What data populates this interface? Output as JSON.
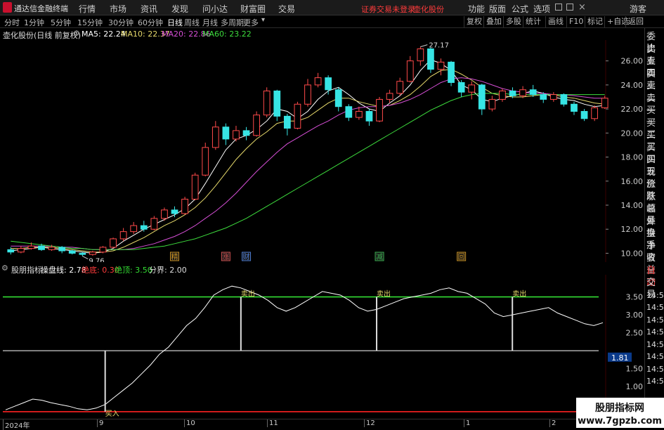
{
  "app": {
    "name": "通达信金融终端"
  },
  "top_menu": [
    "行情",
    "市场",
    "资讯",
    "发现",
    "问小达",
    "财富圈",
    "交易"
  ],
  "status": {
    "login_warning": "证券交易未登录",
    "stock_name": "壶化股份"
  },
  "top_right_menu": [
    "功能",
    "版面",
    "公式",
    "选项"
  ],
  "guest_label": "游客",
  "periods": [
    "分时",
    "1分钟",
    "5分钟",
    "15分钟",
    "30分钟",
    "60分钟",
    "日线",
    "周线",
    "月线",
    "多周期",
    "更多"
  ],
  "active_period": "日线",
  "toolbar_right": [
    "复权",
    "叠加",
    "多股",
    "统计",
    "画线",
    "F10",
    "标记",
    "+自选",
    "返回"
  ],
  "chart_header": {
    "title": "壶化股份(日线 前复权)",
    "ma5": "MA5: 22.24",
    "ma10": "MA10: 22.37",
    "ma20": "MA20: 22.86",
    "ma60": "MA60: 23.22"
  },
  "indicator_header": {
    "name": "股朋指标",
    "line": "操盘线: 2.78",
    "bottom": "绝底: 0.30",
    "top": "绝顶: 3.50",
    "boundary": "分界: 2.00"
  },
  "right_panel": [
    "委比",
    "卖五",
    "卖四",
    "卖三",
    "卖二",
    "卖一",
    "买一",
    "买二",
    "买三",
    "买四",
    "买五",
    "现价",
    "涨跌",
    "涨幅",
    "总量",
    "外盘",
    "换手",
    "净资",
    "收益",
    "自动",
    "交易",
    "14:56",
    "14:56",
    "14:56",
    "14:56",
    "14:56",
    "14:56",
    "14:56",
    "14:56"
  ],
  "x_labels": [
    "2024年",
    "9",
    "10",
    "11",
    "12",
    "1",
    "2"
  ],
  "colors": {
    "up": "#ff4a4a",
    "down": "#37e5e5",
    "ma5": "#ffffff",
    "ma10": "#e6d96b",
    "ma20": "#d64fd6",
    "ma60": "#3ddc3d",
    "indicator": "#ffffff",
    "top_line": "#33dd33",
    "bottom_line": "#ff2222",
    "warning": "#ff3b3b"
  },
  "chart_data": [
    {
      "type": "candlestick",
      "title": "壶化股份(日线 前复权)",
      "y_ticks": [
        "26.00",
        "24.00",
        "22.00",
        "20.00",
        "18.00",
        "16.00",
        "14.00",
        "12.00",
        "10.00"
      ],
      "ylim": [
        9.5,
        27.5
      ],
      "annotations": [
        {
          "label": "27.17",
          "value": 27.17
        },
        {
          "label": "9.76",
          "value": 9.76
        }
      ],
      "markers": [
        "精",
        "涨",
        "财",
        "减",
        "回"
      ],
      "ma_lines": [
        {
          "name": "MA5",
          "values": [
            10.2,
            10.3,
            10.4,
            10.5,
            10.4,
            10.3,
            10.2,
            10.1,
            10.0,
            10.1,
            10.4,
            11.0,
            11.5,
            12.0,
            12.4,
            12.8,
            13.2,
            13.7,
            14.5,
            15.8,
            17.2,
            18.6,
            19.5,
            19.8,
            20.3,
            21.0,
            22.0,
            21.8,
            21.2,
            21.8,
            22.8,
            23.5,
            23.8,
            23.2,
            22.5,
            22.0,
            21.8,
            22.5,
            23.1,
            24.0,
            25.2,
            26.1,
            25.8,
            25.2,
            24.0,
            23.6,
            22.8,
            22.6,
            22.9,
            23.1,
            23.3,
            23.5,
            23.3,
            23.0,
            22.8,
            22.7,
            22.4,
            22.2,
            22.3
          ]
        },
        {
          "name": "MA10",
          "values": [
            10.4,
            10.4,
            10.5,
            10.5,
            10.5,
            10.4,
            10.3,
            10.2,
            10.1,
            10.1,
            10.2,
            10.5,
            10.9,
            11.3,
            11.8,
            12.3,
            12.7,
            13.2,
            13.8,
            14.6,
            15.6,
            16.7,
            17.8,
            18.7,
            19.5,
            20.1,
            20.8,
            21.0,
            21.0,
            21.3,
            21.9,
            22.5,
            22.9,
            22.9,
            22.6,
            22.4,
            22.2,
            22.3,
            22.7,
            23.2,
            23.9,
            24.7,
            25.2,
            25.3,
            24.9,
            24.4,
            23.8,
            23.3,
            23.1,
            23.0,
            23.0,
            23.1,
            23.2,
            23.2,
            23.0,
            22.9,
            22.7,
            22.5,
            22.4
          ]
        },
        {
          "name": "MA20",
          "values": [
            10.6,
            10.6,
            10.6,
            10.6,
            10.6,
            10.5,
            10.5,
            10.4,
            10.3,
            10.3,
            10.3,
            10.3,
            10.4,
            10.6,
            10.8,
            11.1,
            11.4,
            11.8,
            12.3,
            12.9,
            13.5,
            14.2,
            15.0,
            15.9,
            16.8,
            17.6,
            18.4,
            19.1,
            19.6,
            20.1,
            20.6,
            21.0,
            21.5,
            21.9,
            22.1,
            22.2,
            22.2,
            22.3,
            22.5,
            22.8,
            23.2,
            23.7,
            24.2,
            24.5,
            24.6,
            24.5,
            24.3,
            24.0,
            23.7,
            23.5,
            23.4,
            23.3,
            23.3,
            23.2,
            23.2,
            23.1,
            23.0,
            22.9,
            22.9
          ]
        },
        {
          "name": "MA60",
          "values": [
            11.0,
            10.9,
            10.8,
            10.7,
            10.6,
            10.5,
            10.4,
            10.4,
            10.3,
            10.3,
            10.3,
            10.3,
            10.3,
            10.4,
            10.5,
            10.6,
            10.8,
            11.0,
            11.2,
            11.5,
            11.8,
            12.1,
            12.5,
            12.9,
            13.4,
            13.9,
            14.4,
            14.9,
            15.4,
            15.9,
            16.4,
            16.9,
            17.4,
            17.9,
            18.4,
            18.9,
            19.4,
            19.9,
            20.4,
            20.9,
            21.4,
            21.9,
            22.3,
            22.7,
            23.0,
            23.2,
            23.3,
            23.3,
            23.3,
            23.2,
            23.2,
            23.2,
            23.2,
            23.2,
            23.2,
            23.2,
            23.2,
            23.2,
            23.2
          ]
        }
      ],
      "candles": [
        {
          "o": 10.3,
          "c": 10.1,
          "h": 10.5,
          "l": 9.9
        },
        {
          "o": 10.1,
          "c": 10.4,
          "h": 10.6,
          "l": 10.0
        },
        {
          "o": 10.4,
          "c": 10.6,
          "h": 10.9,
          "l": 10.3
        },
        {
          "o": 10.6,
          "c": 10.3,
          "h": 10.8,
          "l": 10.2
        },
        {
          "o": 10.3,
          "c": 10.5,
          "h": 10.7,
          "l": 10.2
        },
        {
          "o": 10.5,
          "c": 10.2,
          "h": 10.6,
          "l": 10.0
        },
        {
          "o": 10.2,
          "c": 10.0,
          "h": 10.3,
          "l": 9.9
        },
        {
          "o": 10.0,
          "c": 9.9,
          "h": 10.1,
          "l": 9.76
        },
        {
          "o": 9.9,
          "c": 10.1,
          "h": 10.2,
          "l": 9.8
        },
        {
          "o": 10.1,
          "c": 10.5,
          "h": 10.6,
          "l": 10.0
        },
        {
          "o": 10.5,
          "c": 11.2,
          "h": 11.3,
          "l": 10.4
        },
        {
          "o": 11.2,
          "c": 11.8,
          "h": 12.1,
          "l": 11.0
        },
        {
          "o": 11.8,
          "c": 12.3,
          "h": 12.6,
          "l": 11.6
        },
        {
          "o": 12.3,
          "c": 12.0,
          "h": 12.7,
          "l": 11.8
        },
        {
          "o": 12.0,
          "c": 12.9,
          "h": 13.1,
          "l": 11.9
        },
        {
          "o": 12.9,
          "c": 13.6,
          "h": 13.8,
          "l": 12.7
        },
        {
          "o": 13.6,
          "c": 13.3,
          "h": 13.9,
          "l": 13.0
        },
        {
          "o": 13.3,
          "c": 14.5,
          "h": 14.7,
          "l": 13.2
        },
        {
          "o": 14.5,
          "c": 16.5,
          "h": 16.7,
          "l": 14.4
        },
        {
          "o": 16.5,
          "c": 18.8,
          "h": 19.2,
          "l": 16.4
        },
        {
          "o": 18.8,
          "c": 20.5,
          "h": 21.0,
          "l": 18.6
        },
        {
          "o": 20.5,
          "c": 19.5,
          "h": 20.8,
          "l": 19.0
        },
        {
          "o": 19.5,
          "c": 20.2,
          "h": 20.6,
          "l": 19.3
        },
        {
          "o": 20.2,
          "c": 19.8,
          "h": 20.5,
          "l": 19.4
        },
        {
          "o": 19.8,
          "c": 21.5,
          "h": 21.8,
          "l": 19.7
        },
        {
          "o": 21.5,
          "c": 23.5,
          "h": 23.8,
          "l": 21.3
        },
        {
          "o": 23.5,
          "c": 21.4,
          "h": 23.6,
          "l": 21.0
        },
        {
          "o": 21.4,
          "c": 20.4,
          "h": 21.6,
          "l": 19.8
        },
        {
          "o": 20.4,
          "c": 22.4,
          "h": 22.6,
          "l": 20.3
        },
        {
          "o": 22.4,
          "c": 24.0,
          "h": 24.5,
          "l": 22.2
        },
        {
          "o": 24.0,
          "c": 24.6,
          "h": 25.0,
          "l": 23.8
        },
        {
          "o": 24.6,
          "c": 23.6,
          "h": 24.8,
          "l": 23.2
        },
        {
          "o": 23.6,
          "c": 22.2,
          "h": 23.8,
          "l": 21.8
        },
        {
          "o": 22.2,
          "c": 21.3,
          "h": 22.4,
          "l": 21.0
        },
        {
          "o": 21.3,
          "c": 21.8,
          "h": 22.2,
          "l": 21.1
        },
        {
          "o": 21.8,
          "c": 21.0,
          "h": 22.0,
          "l": 20.6
        },
        {
          "o": 21.0,
          "c": 22.8,
          "h": 23.0,
          "l": 20.9
        },
        {
          "o": 22.8,
          "c": 23.3,
          "h": 23.6,
          "l": 22.5
        },
        {
          "o": 23.3,
          "c": 24.3,
          "h": 24.6,
          "l": 23.1
        },
        {
          "o": 24.3,
          "c": 26.0,
          "h": 26.4,
          "l": 24.2
        },
        {
          "o": 26.0,
          "c": 27.0,
          "h": 27.17,
          "l": 25.6
        },
        {
          "o": 27.0,
          "c": 25.3,
          "h": 27.1,
          "l": 25.0
        },
        {
          "o": 25.3,
          "c": 25.9,
          "h": 26.2,
          "l": 24.8
        },
        {
          "o": 25.9,
          "c": 24.2,
          "h": 26.0,
          "l": 23.9
        },
        {
          "o": 24.2,
          "c": 23.4,
          "h": 24.4,
          "l": 23.0
        },
        {
          "o": 23.4,
          "c": 24.0,
          "h": 24.3,
          "l": 22.8
        },
        {
          "o": 24.0,
          "c": 22.0,
          "h": 24.1,
          "l": 21.5
        },
        {
          "o": 22.0,
          "c": 22.8,
          "h": 23.1,
          "l": 21.8
        },
        {
          "o": 22.8,
          "c": 23.5,
          "h": 23.7,
          "l": 22.6
        },
        {
          "o": 23.5,
          "c": 23.1,
          "h": 23.8,
          "l": 22.9
        },
        {
          "o": 23.1,
          "c": 23.6,
          "h": 23.9,
          "l": 22.9
        },
        {
          "o": 23.6,
          "c": 23.2,
          "h": 24.0,
          "l": 23.0
        },
        {
          "o": 23.2,
          "c": 22.8,
          "h": 23.4,
          "l": 22.5
        },
        {
          "o": 22.8,
          "c": 23.2,
          "h": 23.4,
          "l": 22.6
        },
        {
          "o": 23.2,
          "c": 22.4,
          "h": 23.3,
          "l": 22.2
        },
        {
          "o": 22.4,
          "c": 21.8,
          "h": 22.6,
          "l": 21.5
        },
        {
          "o": 21.8,
          "c": 21.2,
          "h": 22.0,
          "l": 21.0
        },
        {
          "o": 21.2,
          "c": 22.1,
          "h": 22.3,
          "l": 21.0
        },
        {
          "o": 22.1,
          "c": 22.9,
          "h": 23.1,
          "l": 22.0
        }
      ]
    },
    {
      "type": "line",
      "title": "股朋指标",
      "y_ticks": [
        "3.50",
        "3.00",
        "2.50",
        "1.81",
        "1.50",
        "1.00"
      ],
      "ylim": [
        0.2,
        4.0
      ],
      "boundary_lines": [
        {
          "name": "绝顶",
          "value": 3.5
        },
        {
          "name": "分界",
          "value": 2.0
        },
        {
          "name": "绝底",
          "value": 0.3
        }
      ],
      "signals": [
        {
          "label": "买入",
          "index": 10
        },
        {
          "label": "卖出",
          "index": 23
        },
        {
          "label": "卖出",
          "index": 36
        },
        {
          "label": "卖出",
          "index": 49
        }
      ],
      "series": [
        {
          "name": "操盘线",
          "values": [
            0.35,
            0.45,
            0.55,
            0.65,
            0.62,
            0.55,
            0.5,
            0.45,
            0.38,
            0.35,
            0.4,
            0.5,
            0.7,
            0.9,
            1.1,
            1.35,
            1.6,
            1.9,
            2.1,
            2.4,
            2.7,
            2.9,
            3.2,
            3.55,
            3.7,
            3.8,
            3.75,
            3.65,
            3.55,
            3.4,
            3.2,
            3.1,
            3.2,
            3.35,
            3.5,
            3.65,
            3.6,
            3.55,
            3.4,
            3.2,
            3.1,
            3.15,
            3.25,
            3.35,
            3.45,
            3.5,
            3.55,
            3.6,
            3.7,
            3.75,
            3.65,
            3.6,
            3.45,
            3.3,
            3.05,
            2.95,
            3.0,
            3.05,
            3.1,
            3.15,
            3.2,
            3.05,
            2.95,
            2.85,
            2.75,
            2.7,
            2.78
          ]
        }
      ]
    }
  ]
}
